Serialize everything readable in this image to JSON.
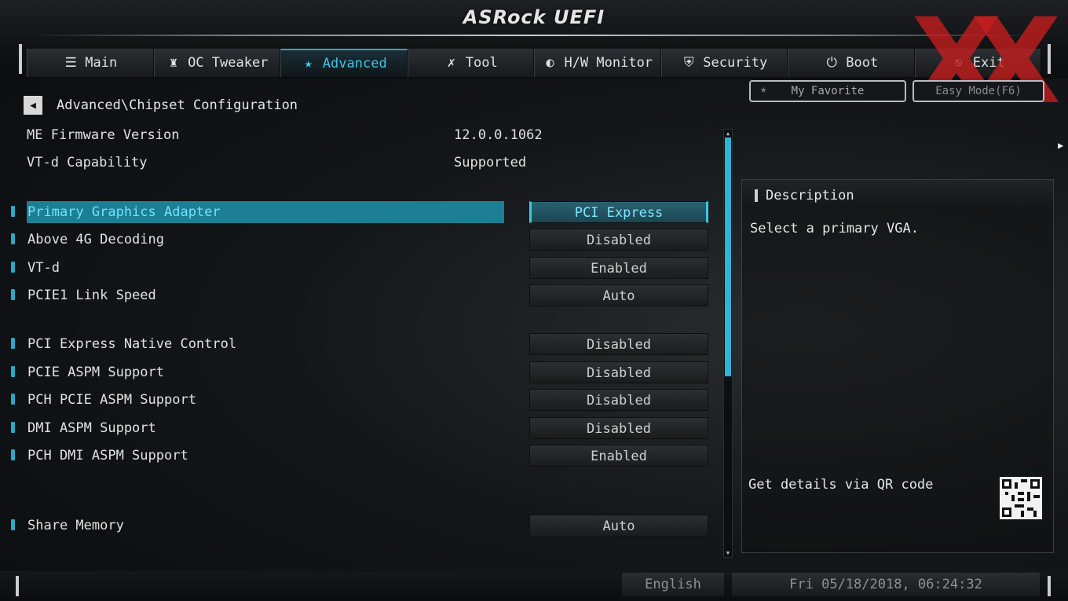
{
  "app": {
    "brand": "ASRock UEFI"
  },
  "tabs": [
    {
      "label": "Main",
      "icon": "list-icon",
      "glyph": "☰"
    },
    {
      "label": "OC Tweaker",
      "icon": "rocket-icon",
      "glyph": "♜"
    },
    {
      "label": "Advanced",
      "icon": "star-icon",
      "glyph": "★",
      "active": true
    },
    {
      "label": "Tool",
      "icon": "wrench-icon",
      "glyph": "✗"
    },
    {
      "label": "H/W Monitor",
      "icon": "monitor-icon",
      "glyph": "◐"
    },
    {
      "label": "Security",
      "icon": "shield-icon",
      "glyph": "⛨"
    },
    {
      "label": "Boot",
      "icon": "power-icon",
      "glyph": "⏻"
    },
    {
      "label": "Exit",
      "icon": "exit-icon",
      "glyph": "⎋"
    }
  ],
  "header": {
    "breadcrumb": "Advanced\\Chipset Configuration",
    "favorite_label": "My Favorite",
    "easy_mode_label": "Easy Mode(F6)",
    "watermark": "XX"
  },
  "info": [
    {
      "label": "ME Firmware Version",
      "value": "12.0.0.1062"
    },
    {
      "label": "VT-d Capability",
      "value": "Supported"
    }
  ],
  "settings": [
    {
      "label": "Primary Graphics Adapter",
      "value": "PCI Express",
      "selected": true
    },
    {
      "label": "Above 4G Decoding",
      "value": "Disabled"
    },
    {
      "label": "VT-d",
      "value": "Enabled"
    },
    {
      "label": "PCIE1 Link Speed",
      "value": "Auto"
    },
    {
      "label": "PCI Express Native Control",
      "value": "Disabled"
    },
    {
      "label": "PCIE ASPM Support",
      "value": "Disabled"
    },
    {
      "label": "PCH PCIE ASPM Support",
      "value": "Disabled"
    },
    {
      "label": "DMI ASPM Support",
      "value": "Disabled"
    },
    {
      "label": "PCH DMI ASPM Support",
      "value": "Enabled"
    },
    {
      "label": "Share Memory",
      "value": "Auto"
    }
  ],
  "description": {
    "title": "Description",
    "text": "Select a primary VGA.",
    "qr_label": "Get details via QR code"
  },
  "footer": {
    "language": "English",
    "datetime": "Fri 05/18/2018, 06:24:32"
  },
  "colors": {
    "accent": "#2aa8c7",
    "highlight_text": "#6fe3ff",
    "watermark": "#c81e1e"
  }
}
